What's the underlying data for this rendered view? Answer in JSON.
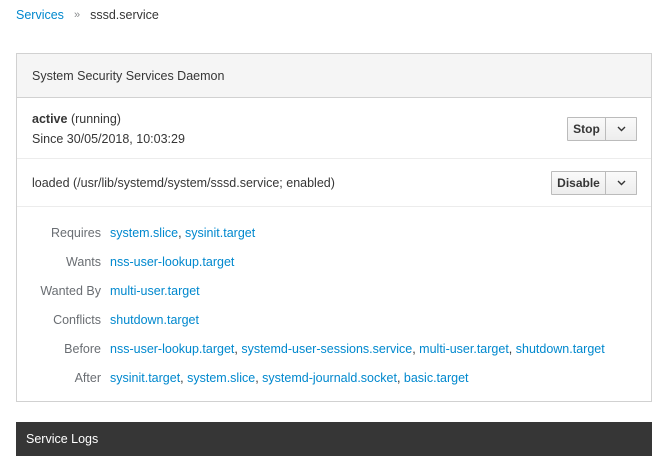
{
  "breadcrumb": {
    "parent": "Services",
    "separator": "»",
    "current": "sssd.service"
  },
  "panel": {
    "title": "System Security Services Daemon",
    "status": {
      "state": "active",
      "detail": "(running)",
      "since": "Since 30/05/2018, 10:03:29"
    },
    "stop_button": {
      "label": "Stop"
    },
    "loaded": "loaded (/usr/lib/systemd/system/sssd.service; enabled)",
    "disable_button": {
      "label": "Disable"
    },
    "deps": {
      "requires": {
        "label": "Requires",
        "items": [
          "system.slice",
          "sysinit.target"
        ]
      },
      "wants": {
        "label": "Wants",
        "items": [
          "nss-user-lookup.target"
        ]
      },
      "wanted_by": {
        "label": "Wanted By",
        "items": [
          "multi-user.target"
        ]
      },
      "conflicts": {
        "label": "Conflicts",
        "items": [
          "shutdown.target"
        ]
      },
      "before": {
        "label": "Before",
        "items": [
          "nss-user-lookup.target",
          "systemd-user-sessions.service",
          "multi-user.target",
          "shutdown.target"
        ]
      },
      "after": {
        "label": "After",
        "items": [
          "sysinit.target",
          "system.slice",
          "systemd-journald.socket",
          "basic.target"
        ]
      }
    }
  },
  "logs": {
    "title": "Service Logs"
  },
  "colors": {
    "link": "#0088ce",
    "logs_bar": "#363636",
    "label_grey": "#6a6e73"
  },
  "icons": {
    "caret": "chevron-down-icon"
  }
}
